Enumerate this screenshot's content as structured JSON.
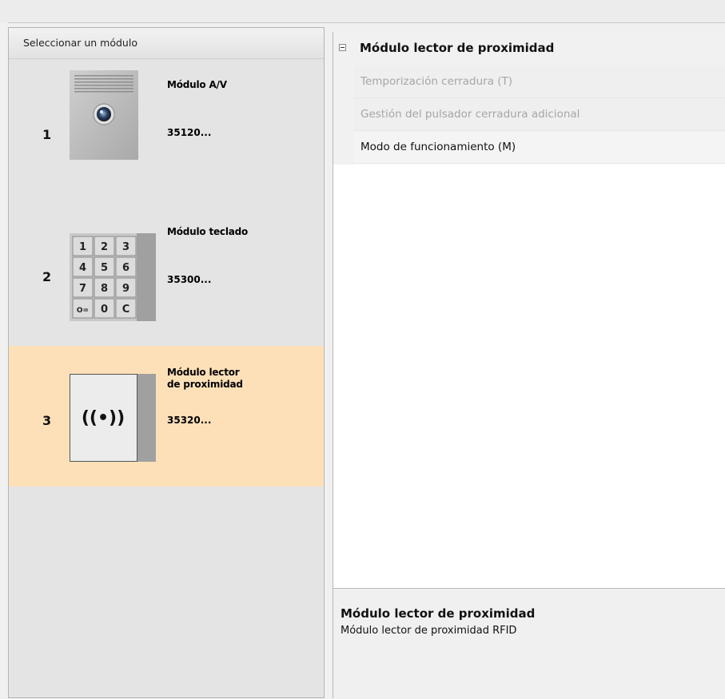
{
  "left_panel": {
    "header": "Seleccionar un módulo",
    "modules": [
      {
        "index": "1",
        "name": "Módulo A/V",
        "code": "35120...",
        "icon": "audio-video-module-icon",
        "selected": false
      },
      {
        "index": "2",
        "name": "Módulo teclado",
        "code": "35300...",
        "icon": "keypad-module-icon",
        "selected": false
      },
      {
        "index": "3",
        "name": "Módulo lector\nde proximidad",
        "code": "35320...",
        "icon": "proximity-reader-module-icon",
        "selected": true
      }
    ],
    "keypad_keys": [
      "1",
      "2",
      "3",
      "4",
      "5",
      "6",
      "7",
      "8",
      "9",
      "O=",
      "0",
      "C"
    ],
    "proximity_symbol": "((•))"
  },
  "properties": {
    "category": "Módulo lector de proximidad",
    "rows": [
      {
        "label": "Temporización cerradura (T)",
        "enabled": false
      },
      {
        "label": "Gestión del pulsador cerradura adicional",
        "enabled": false
      },
      {
        "label": "Modo de funcionamiento (M)",
        "enabled": true
      }
    ]
  },
  "description": {
    "title": "Módulo lector de proximidad",
    "text": "Módulo lector de proximidad RFID"
  },
  "colors": {
    "selected_bg": "#fde0b8",
    "panel_bg": "#e4e4e4"
  }
}
